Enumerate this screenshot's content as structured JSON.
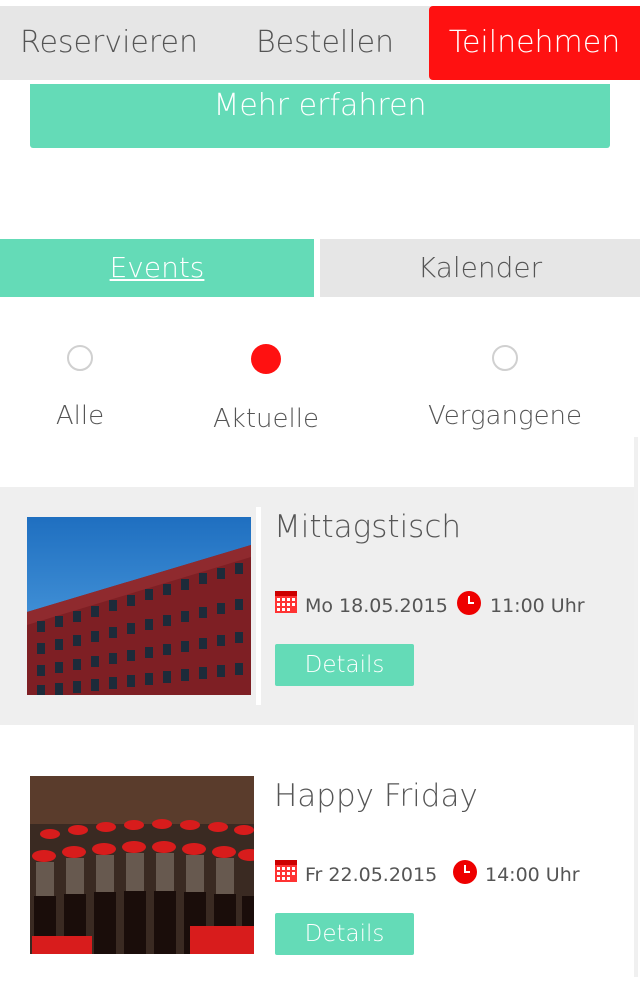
{
  "topnav": {
    "tabs": [
      {
        "label": "Reservieren"
      },
      {
        "label": "Bestellen"
      },
      {
        "label": "Teilnehmen"
      }
    ],
    "active_color": "#ff1111"
  },
  "more_button": {
    "label": "Mehr erfahren"
  },
  "segments": {
    "events": "Events",
    "calendar": "Kalender",
    "active_color": "#64dbb7"
  },
  "filter": {
    "options": [
      {
        "label": "Alle",
        "selected": false
      },
      {
        "label": "Aktuelle",
        "selected": true
      },
      {
        "label": "Vergangene",
        "selected": false
      }
    ]
  },
  "events": [
    {
      "title": "Mittagstisch",
      "date": "Mo 18.05.2015",
      "time": "11:00 Uhr",
      "details_label": "Details",
      "image": "red-brick-office-building-photo"
    },
    {
      "title": "Happy Friday",
      "date": "Fr 22.05.2015",
      "time": "14:00 Uhr",
      "details_label": "Details",
      "image": "coca-cola-bottles-photo"
    }
  ],
  "icons": {
    "calendar": "calendar-icon",
    "clock": "clock-icon"
  },
  "colors": {
    "accent_green": "#64dbb7",
    "accent_red": "#ff1111",
    "gray_bg": "#e6e6e6"
  }
}
